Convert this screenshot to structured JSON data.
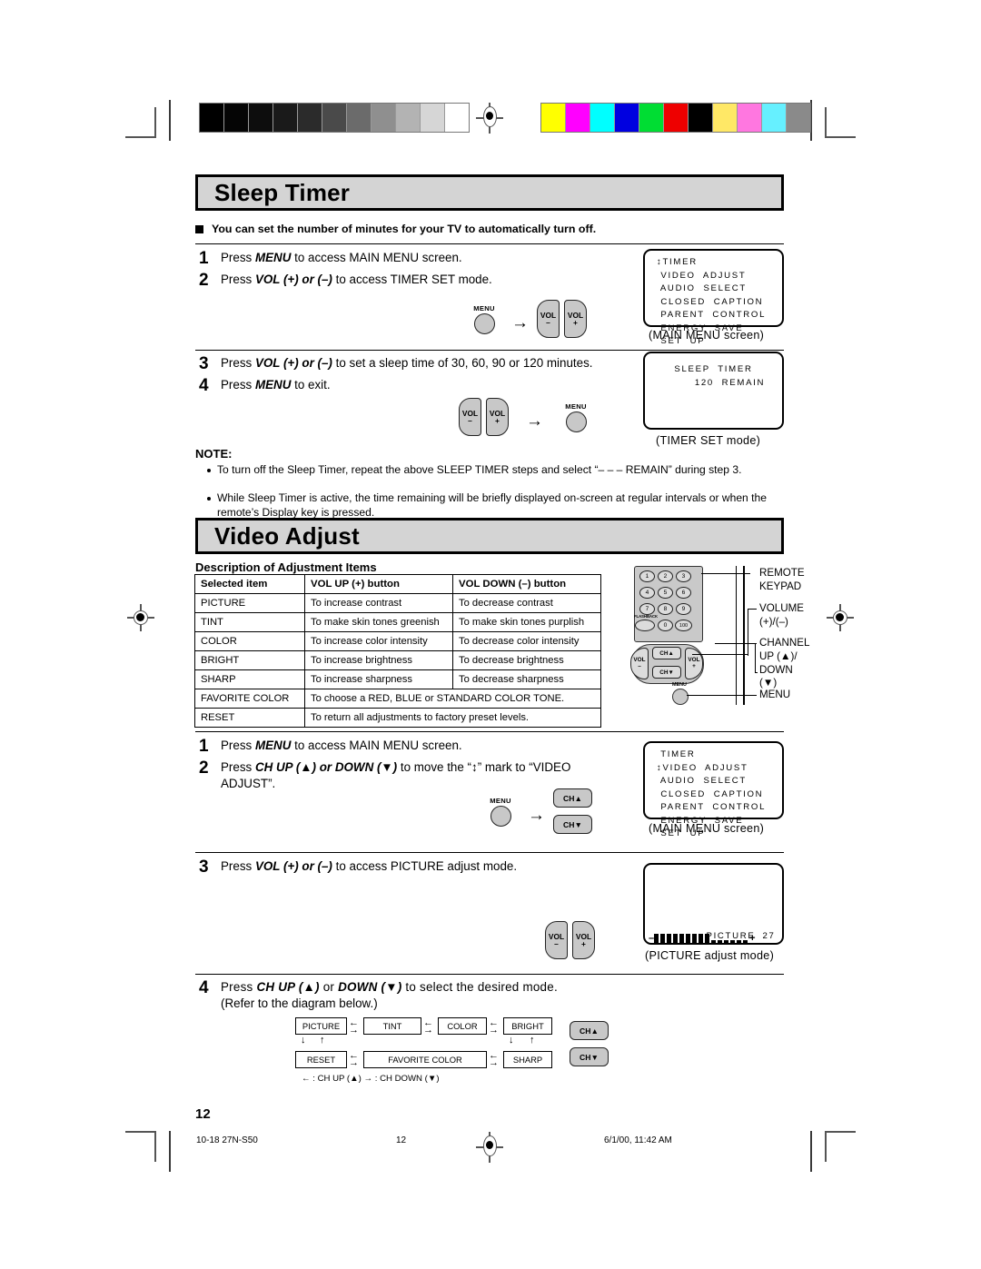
{
  "document": {
    "page_number": "12",
    "footer": {
      "left": "10-18 27N-S50",
      "center": "12",
      "right": "6/1/00, 11:42 AM"
    }
  },
  "colors": {
    "banner_fill": "#d4d4d4",
    "button_fill": "#c8c8c8",
    "keypad_fill": "#c9c9c9",
    "line": "#000000"
  },
  "grayscale_bar": [
    "#000000",
    "#050505",
    "#0d0d0d",
    "#1a1a1a",
    "#2b2b2b",
    "#4a4a4a",
    "#6b6b6b",
    "#8f8f8f",
    "#b3b3b3",
    "#d6d6d6",
    "#ffffff"
  ],
  "color_bar": [
    "#ffff00",
    "#ff00ff",
    "#00ffff",
    "#0000e0",
    "#00dd33",
    "#ee0000",
    "#000000",
    "#ffe866",
    "#ff77e0",
    "#66f0ff",
    "#8a8a8a"
  ],
  "sleep_timer": {
    "heading": "Sleep Timer",
    "intro": "You can set the number of minutes for your TV to automatically turn off.",
    "steps_group1": [
      {
        "num": "1",
        "text_pre": "Press ",
        "bold": "MENU",
        "text_post": " to access MAIN MENU screen."
      },
      {
        "num": "2",
        "text_pre": "Press ",
        "bold": "VOL (+) or (–)",
        "text_post": " to access TIMER SET mode."
      }
    ],
    "steps_group2": [
      {
        "num": "3",
        "text_pre": "Press ",
        "bold": "VOL (+) or (–)",
        "text_post": " to set a sleep time of 30, 60, 90 or 120 minutes."
      },
      {
        "num": "4",
        "text_pre": "Press ",
        "bold": "MENU",
        "text_post": " to exit."
      }
    ],
    "buttons_group1": {
      "menu_label": "MENU",
      "arrow": "→",
      "vol_minus_top": "VOL",
      "vol_minus_bottom": "–",
      "vol_plus_top": "VOL",
      "vol_plus_bottom": "+"
    },
    "buttons_group2": {
      "menu_label": "MENU",
      "arrow": "→",
      "vol_minus_top": "VOL",
      "vol_minus_bottom": "–",
      "vol_plus_top": "VOL",
      "vol_plus_bottom": "+"
    },
    "main_menu_screen": {
      "lines": [
        "↕TIMER",
        " VIDEO  ADJUST",
        " AUDIO  SELECT",
        " CLOSED  CAPTION",
        " PARENT  CONTROL",
        " ENERGY  SAVE",
        " SET  UP"
      ],
      "caption": "(MAIN MENU screen)"
    },
    "timer_set_screen": {
      "line1": "SLEEP  TIMER",
      "line2": "120  REMAIN",
      "caption": "(TIMER SET mode)"
    },
    "note": {
      "title": "NOTE:",
      "items": [
        "To turn off the Sleep Timer, repeat the above SLEEP TIMER steps and select “– – – REMAIN” during step 3.",
        "While Sleep Timer is active, the time remaining will be briefly displayed on-screen at regular intervals or when the remote’s Display key is pressed."
      ]
    }
  },
  "video_adjust": {
    "heading": "Video Adjust",
    "table_title": "Description of Adjustment Items",
    "table": {
      "headers": [
        "Selected item",
        "VOL UP (+) button",
        "VOL DOWN (–) button"
      ],
      "rows": [
        {
          "item": "PICTURE",
          "up": "To increase contrast",
          "down": "To decrease contrast",
          "span": false
        },
        {
          "item": "TINT",
          "up": "To make skin tones greenish",
          "down": "To make skin tones purplish",
          "span": false
        },
        {
          "item": "COLOR",
          "up": "To increase color intensity",
          "down": "To decrease color intensity",
          "span": false
        },
        {
          "item": "BRIGHT",
          "up": "To increase brightness",
          "down": "To decrease brightness",
          "span": false
        },
        {
          "item": "SHARP",
          "up": "To increase sharpness",
          "down": "To decrease sharpness",
          "span": false
        },
        {
          "item": "FAVORITE COLOR",
          "up": "To choose a RED, BLUE or STANDARD COLOR TONE.",
          "down": "",
          "span": true
        },
        {
          "item": "RESET",
          "up": "To return all adjustments to factory preset levels.",
          "down": "",
          "span": true
        }
      ]
    },
    "remote_diagram": {
      "keys": [
        "1",
        "2",
        "3",
        "4",
        "5",
        "6",
        "7",
        "8",
        "9",
        "0",
        "100"
      ],
      "flashback_label": "FLASHBACK",
      "vol_minus_top": "VOL",
      "vol_minus_bottom": "–",
      "vol_plus_top": "VOL",
      "vol_plus_bottom": "+",
      "ch_up": "CH▲",
      "ch_down": "CH▼",
      "menu_label": "MENU",
      "labels": [
        "REMOTE\nKEYPAD",
        "VOLUME\n(+)/(–)",
        "CHANNEL\nUP (▲)/\nDOWN (▼)",
        "MENU"
      ],
      "label_remote_l1": "REMOTE",
      "label_remote_l2": "KEYPAD",
      "label_volume_l1": "VOLUME",
      "label_volume_l2": "(+)/(–)",
      "label_channel_l1": "CHANNEL",
      "label_channel_l2": "UP (▲)/",
      "label_channel_l3": "DOWN (▼)",
      "label_menu": "MENU"
    },
    "steps_group1": [
      {
        "num": "1",
        "text_pre": "Press ",
        "bold": "MENU",
        "text_post": " to access MAIN MENU screen."
      },
      {
        "num": "2",
        "text_pre": "Press ",
        "bold": "CH UP (▲) or DOWN (▼)",
        "text_post": " to move the “↕” mark to “VIDEO ADJUST”."
      }
    ],
    "buttons_group1": {
      "menu_label": "MENU",
      "arrow": "→",
      "ch_up": "CH▲",
      "ch_down": "CH▼"
    },
    "main_menu_screen": {
      "lines": [
        " TIMER",
        "↕VIDEO  ADJUST",
        " AUDIO  SELECT",
        " CLOSED  CAPTION",
        " PARENT  CONTROL",
        " ENERGY  SAVE",
        " SET  UP"
      ],
      "caption": "(MAIN MENU screen)"
    },
    "step3": {
      "num": "3",
      "text_pre": "Press ",
      "bold": "VOL (+) or (–)",
      "text_post": " to access PICTURE adjust mode."
    },
    "buttons_group2": {
      "vol_minus_top": "VOL",
      "vol_minus_bottom": "–",
      "vol_plus_top": "VOL",
      "vol_plus_bottom": "+"
    },
    "picture_screen": {
      "label": "PICTURE",
      "value": "27",
      "minus": "–",
      "plus": "+",
      "filled_segments": 9,
      "empty_segments": 6,
      "caption": "(PICTURE adjust mode)"
    },
    "step4": {
      "num": "4",
      "text_pre": "Press ",
      "bold": "CH UP (▲)",
      "mid": " or ",
      "bold2": "DOWN (▼)",
      "text_post": " to select the desired mode.",
      "text_line2": "(Refer to the diagram below.)"
    },
    "flow_diagram": {
      "row1": [
        "PICTURE",
        "TINT",
        "COLOR",
        "BRIGHT"
      ],
      "row2": [
        "RESET",
        "FAVORITE COLOR",
        "SHARP"
      ],
      "legend": "← : CH UP (▲)    → : CH DOWN (▼)",
      "ch_up": "CH▲",
      "ch_down": "CH▼"
    }
  }
}
